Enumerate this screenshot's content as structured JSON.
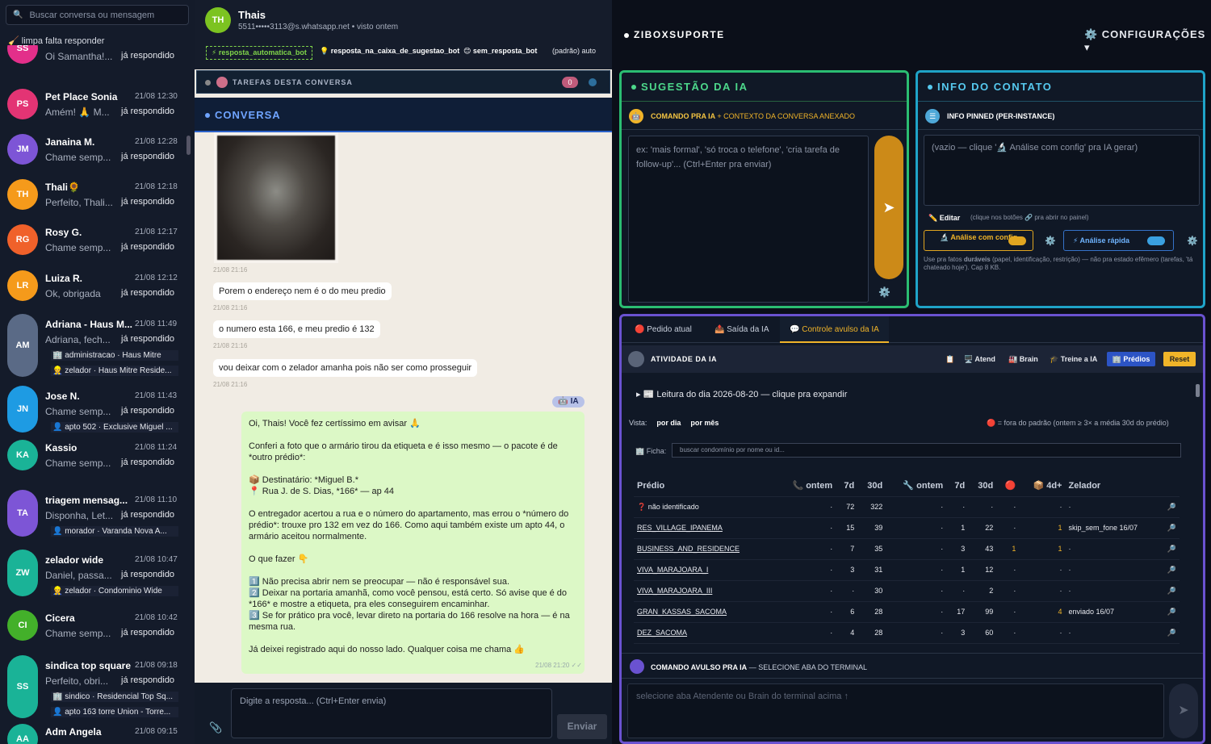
{
  "sidebar": {
    "search_placeholder": "Buscar conversa ou mensagem",
    "filter_label": "🧹 limpa falta responder",
    "conversations": [
      {
        "initials": "SS",
        "name": "",
        "time": "",
        "preview": "Oi Samantha!...",
        "status": "já respondido",
        "color": "#e32f8a"
      },
      {
        "initials": "PS",
        "name": "Pet Place Sonia",
        "time": "21/08 12:30",
        "preview": "Amém! 🙏 M...",
        "status": "já respondido",
        "color": "#e33474"
      },
      {
        "initials": "JM",
        "name": "Janaina M.",
        "time": "21/08 12:28",
        "preview": "Chame semp...",
        "status": "já respondido",
        "color": "#7d55d6"
      },
      {
        "initials": "TH",
        "name": "Thali🌻",
        "time": "21/08 12:18",
        "preview": "Perfeito, Thali...",
        "status": "já respondido",
        "color": "#f59a1b"
      },
      {
        "initials": "RG",
        "name": "Rosy G.",
        "time": "21/08 12:17",
        "preview": "Chame semp...",
        "status": "já respondido",
        "color": "#f0612a"
      },
      {
        "initials": "LR",
        "name": "Luiza R.",
        "time": "21/08 12:12",
        "preview": "Ok, obrigada",
        "status": "já respondido",
        "color": "#f59a1b"
      },
      {
        "initials": "AM",
        "name": "Adriana - Haus M...",
        "time": "21/08 11:49",
        "preview": "Adriana, fech...",
        "status": "já respondido",
        "color": "#5a6a86",
        "tags": [
          "🏢 administracao · Haus Mitre",
          "👷 zelador · Haus Mitre Reside..."
        ]
      },
      {
        "initials": "JN",
        "name": "Jose N.",
        "time": "21/08 11:43",
        "preview": "Chame semp...",
        "status": "já respondido",
        "color": "#1e9be3",
        "tags": [
          "👤 apto 502 · Exclusive Miguel ..."
        ]
      },
      {
        "initials": "KA",
        "name": "Kassio",
        "time": "21/08 11:24",
        "preview": "Chame semp...",
        "status": "já respondido",
        "color": "#1ab397"
      },
      {
        "initials": "TA",
        "name": "triagem mensag...",
        "time": "21/08 11:10",
        "preview": "Disponha, Let...",
        "status": "já respondido",
        "color": "#7d55d6",
        "tags": [
          "👤 morador · Varanda Nova A..."
        ]
      },
      {
        "initials": "ZW",
        "name": "zelador wide",
        "time": "21/08 10:47",
        "preview": "Daniel, passa...",
        "status": "já respondido",
        "color": "#1ab397",
        "tags": [
          "👷 zelador · Condominio Wide"
        ]
      },
      {
        "initials": "CI",
        "name": "Cicera",
        "time": "21/08 10:42",
        "preview": "Chame semp...",
        "status": "já respondido",
        "color": "#43b02a"
      },
      {
        "initials": "SS",
        "name": "sindica top square",
        "time": "21/08 09:18",
        "preview": "Perfeito, obri...",
        "status": "já respondido",
        "color": "#1ab397",
        "tags": [
          "🏢 sindico · Residencial Top Sq...",
          "👤 apto 163 torre Union - Torre..."
        ]
      },
      {
        "initials": "AA",
        "name": "Adm Angela",
        "time": "21/08 09:15",
        "preview": "",
        "status": "",
        "color": "#1ab397"
      }
    ]
  },
  "chat": {
    "avatar": "TH",
    "name": "Thais",
    "subtitle": "5511•••••3113@s.whatsapp.net • visto ontem",
    "tags": [
      "⚡ resposta_automatica_bot",
      "💡 resposta_na_caixa_de_sugestao_bot",
      "😊 sem_resposta_bot",
      "(padrão) auto"
    ],
    "tasks_label": "TAREFAS DESTA CONVERSA",
    "tasks_count": "0",
    "conversation_label": "CONVERSA",
    "messages": [
      {
        "time": "21/08 21:16"
      },
      {
        "text": "Porem o endereço nem é o do meu predio",
        "time": "21/08 21:16"
      },
      {
        "text": "o numero esta 166, e meu predio é 132",
        "time": "21/08 21:16"
      },
      {
        "text": "vou deixar com o zelador amanha pois não ser como prosseguir",
        "time": "21/08 21:16"
      }
    ],
    "ia_badge": "🤖 IA",
    "ai_message": [
      "Oi, Thais! Você fez certíssimo em avisar 🙏",
      "Conferi a foto que o armário tirou da etiqueta e é isso mesmo — o pacote é de *outro prédio*:",
      "📦 Destinatário: *Miguel B.*\n📍 Rua J. de S. Dias, *166* — ap 44",
      "O entregador acertou a rua e o número do apartamento, mas errou o *número do prédio*: trouxe pro 132 em vez do 166. Como aqui também existe um apto 44, o armário aceitou normalmente.",
      "O que fazer 👇",
      "1️⃣ Não precisa abrir nem se preocupar — não é responsável sua.\n2️⃣ Deixar na portaria amanhã, como você pensou, está certo. Só avise que é do *166* e mostre a etiqueta, pra eles conseguirem encaminhar.\n3️⃣ Se for prático pra você, levar direto na portaria do 166 resolve na hora — é na mesma rua.",
      "Já deixei registrado aqui do nosso lado. Qualquer coisa me chama 👍"
    ],
    "ai_time": "21/08 21:20 ✓✓",
    "input_placeholder": "Digite a resposta... (Ctrl+Enter envia)",
    "send_label": "Enviar"
  },
  "right": {
    "title": "ZIBOXSUPORTE",
    "config_label": "⚙️ CONFIGURAÇÕES ▾",
    "suggestion": {
      "title": "SUGESTÃO DA IA",
      "sub_bold": "COMANDO PRA IA",
      "sub_rest": "+ CONTEXTO DA CONVERSA ANEXADO",
      "placeholder": "ex: 'mais formal', 'só troca o telefone', 'cria tarefa de follow-up'... (Ctrl+Enter pra enviar)"
    },
    "contact": {
      "title": "INFO DO CONTATO",
      "sub": "INFO PINNED (PER-INSTANCE)",
      "placeholder": "(vazio — clique '🔬 Análise com config' pra IA gerar)",
      "edit_label": "✏️ Editar",
      "edit_hint": "(clique nos botões 🔗 pra abrir no painel)",
      "btn_config": "🔬 Análise com config",
      "btn_fast": "⚡ Análise rápida",
      "note_pre": "Use pra fatos ",
      "note_bold": "duráveis",
      "note_post": " (papel, identificação, restrição) — não pra estado efêmero (tarefas, 'tá chateado hoje'). Cap 8 KB."
    },
    "terminal": {
      "tabs": [
        "🔴 Pedido atual",
        "📤 Saída da IA",
        "💬 Controle avulso da IA"
      ],
      "activity_title": "ATIVIDADE DA IA",
      "toolbar": [
        "📋",
        "🖥️ Atend",
        "🏭 Brain",
        "🎓 Treine a IA"
      ],
      "btn_predios": "🏢 Prédios",
      "btn_reset": "Reset",
      "leitura": "▸ 📰 Leitura do dia 2026-08-20 — clique pra expandir",
      "vista_label": "Vista:",
      "vista_options": [
        "por dia",
        "por mês"
      ],
      "legend": "🔴 = fora do padrão (ontem ≥ 3× a média 30d do prédio)",
      "ficha_label": "🏢 Ficha:",
      "ficha_placeholder": "buscar condomínio por nome ou id...",
      "columns": [
        "Prédio",
        "📞 ontem",
        "7d",
        "30d",
        "🔧 ontem",
        "7d",
        "30d",
        "🔴",
        "📦 4d+",
        "Zelador"
      ],
      "rows": [
        {
          "predio": "❓ não identificado",
          "c1": "·",
          "c2": "72",
          "c3": "322",
          "c4": "·",
          "c5": "·",
          "c6": "·",
          "c7": "·",
          "c8": "·",
          "zelador": "·"
        },
        {
          "predio": "RES_VILLAGE_IPANEMA",
          "c1": "·",
          "c2": "15",
          "c3": "39",
          "c4": "·",
          "c5": "1",
          "c6": "22",
          "c7": "·",
          "c8": "1",
          "zelador": "skip_sem_fone 16/07"
        },
        {
          "predio": "BUSINESS_AND_RESIDENCE",
          "c1": "·",
          "c2": "7",
          "c3": "35",
          "c4": "·",
          "c5": "3",
          "c6": "43",
          "c7": "1",
          "c8": "1",
          "zelador": "·"
        },
        {
          "predio": "VIVA_MARAJOARA_I",
          "c1": "·",
          "c2": "3",
          "c3": "31",
          "c4": "·",
          "c5": "1",
          "c6": "12",
          "c7": "·",
          "c8": "·",
          "zelador": "·"
        },
        {
          "predio": "VIVA_MARAJOARA_III",
          "c1": "·",
          "c2": "·",
          "c3": "30",
          "c4": "·",
          "c5": "·",
          "c6": "2",
          "c7": "·",
          "c8": "·",
          "zelador": "·"
        },
        {
          "predio": "GRAN_KASSAS_SACOMA",
          "c1": "·",
          "c2": "6",
          "c3": "28",
          "c4": "·",
          "c5": "17",
          "c6": "99",
          "c7": "·",
          "c8": "4",
          "zelador": "enviado 16/07"
        },
        {
          "predio": "DEZ_SACOMA",
          "c1": "·",
          "c2": "4",
          "c3": "28",
          "c4": "·",
          "c5": "3",
          "c6": "60",
          "c7": "·",
          "c8": "·",
          "zelador": "·"
        }
      ],
      "avulso_bold": "COMANDO AVULSO PRA IA",
      "avulso_rest": "— SELECIONE ABA DO TERMINAL",
      "avulso_placeholder": "selecione aba Atendente ou Brain do terminal acima ↑"
    }
  }
}
